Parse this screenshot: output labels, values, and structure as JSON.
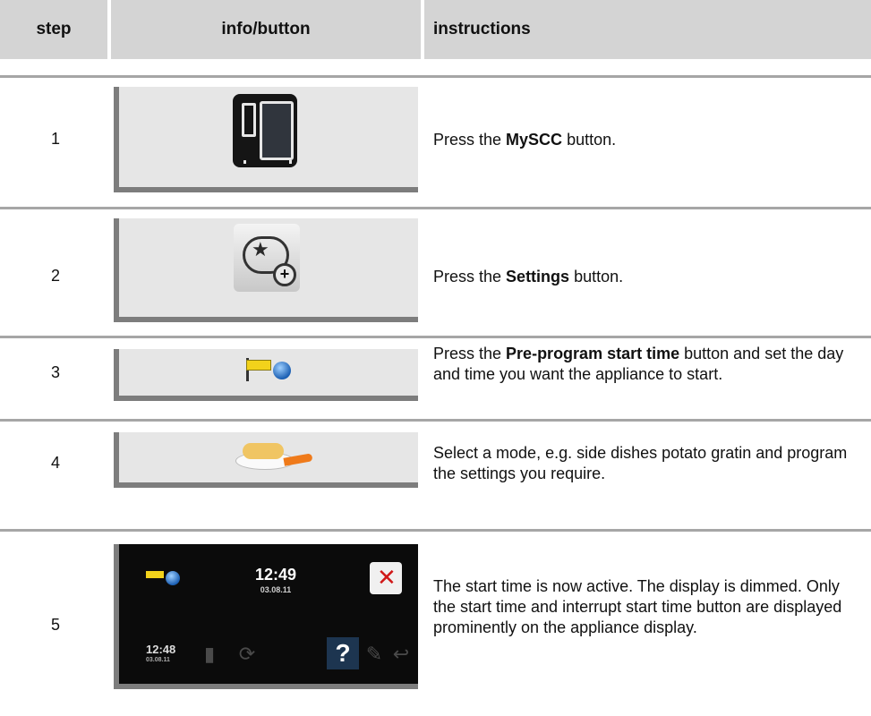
{
  "header": {
    "step": "step",
    "info": "info/button",
    "instructions": "instructions"
  },
  "rows": [
    {
      "step": "1",
      "icon": "mysc-oven-icon",
      "instr_pre": "Press the ",
      "instr_bold": "MySCC",
      "instr_post": " button."
    },
    {
      "step": "2",
      "icon": "settings-cloud-plus-icon",
      "instr_pre": "Press the ",
      "instr_bold": "Settings",
      "instr_post": " button."
    },
    {
      "step": "3",
      "icon": "preprogram-start-time-icon",
      "instr_pre": "Press the ",
      "instr_bold": "Pre-program start time",
      "instr_post": " button and set the day and time you want the appliance to start."
    },
    {
      "step": "4",
      "icon": "potato-gratin-dish-icon",
      "instr": "Select a mode, e.g. side dishes potato gratin and program the settings you require."
    },
    {
      "step": "5",
      "screen": {
        "time": "12:49",
        "date": "03.08.11",
        "clock": "12:48",
        "clock_date": "03.08.11",
        "help": "?"
      },
      "instr": "The start time is now active. The display is dimmed. Only the start time and interrupt start time button are displayed prominently on the appliance display."
    }
  ]
}
